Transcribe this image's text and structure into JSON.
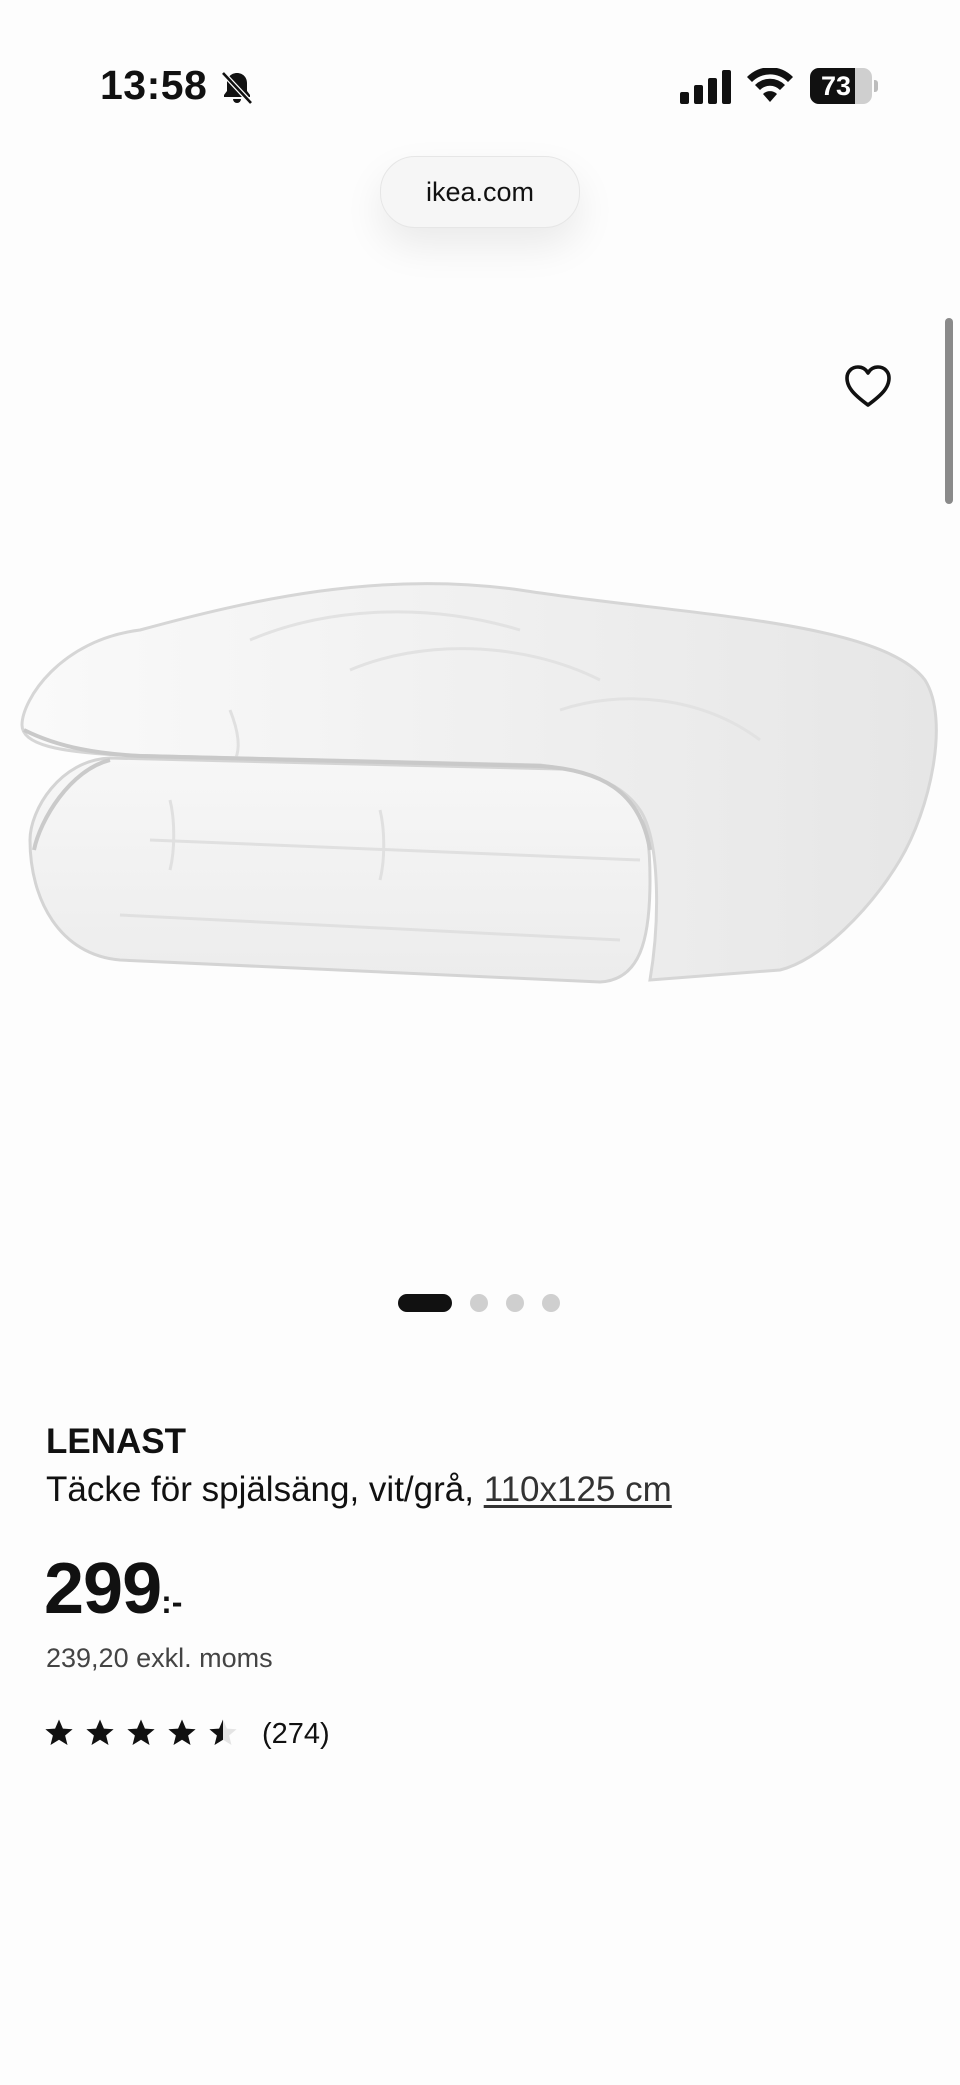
{
  "status_bar": {
    "time": "13:58",
    "battery_level": "73",
    "battery_fraction": 0.73,
    "icons": [
      "bell-slash-icon",
      "signal-icon",
      "wifi-icon",
      "battery-icon"
    ]
  },
  "browser": {
    "url": "ikea.com"
  },
  "product": {
    "image_icon": "folded-duvet-image",
    "carousel": {
      "total": 4,
      "active_index": 0
    },
    "name": "LENAST",
    "description": "Täcke för spjälsäng, vit/grå, ",
    "size": "110x125 cm",
    "price": "299",
    "price_suffix": ":-",
    "price_excl_vat": "239,20 exkl. moms",
    "rating": 4.5,
    "review_count": "(274)",
    "favorite_icon": "heart-outline-icon"
  },
  "colors": {
    "text": "#111111",
    "inactive_dot": "#cfcfcf",
    "star": "#111111"
  }
}
